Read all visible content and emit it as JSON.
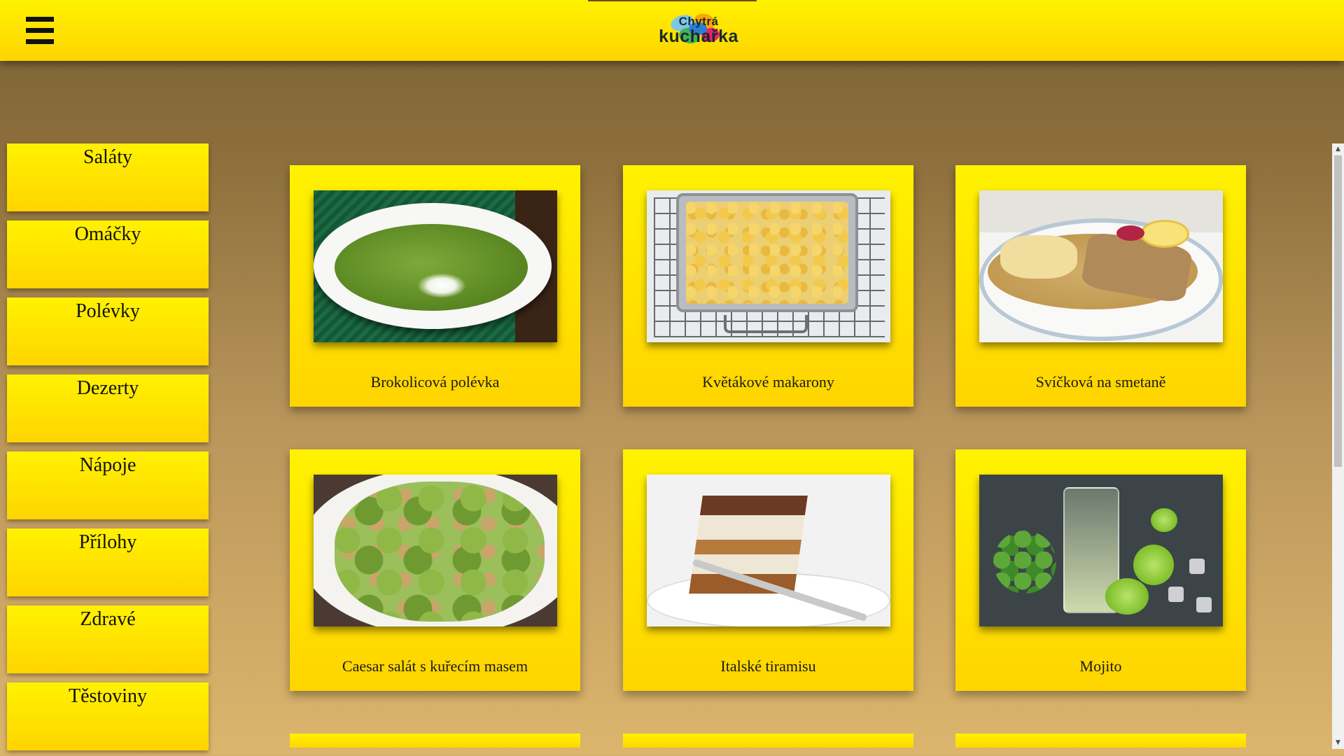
{
  "header": {
    "menu_icon": "hamburger-menu-icon",
    "logo_line1": "Chytrá",
    "logo_line2": "kuchařka"
  },
  "sidebar": {
    "items": [
      {
        "label": "Saláty"
      },
      {
        "label": "Omáčky"
      },
      {
        "label": "Polévky"
      },
      {
        "label": "Dezerty"
      },
      {
        "label": "Nápoje"
      },
      {
        "label": "Přílohy"
      },
      {
        "label": "Zdravé"
      },
      {
        "label": "Těstoviny"
      }
    ]
  },
  "recipes": [
    {
      "title": "Brokolicová polévka",
      "image": "broccoli-soup-photo"
    },
    {
      "title": "Květákové makarony",
      "image": "cauliflower-macaroni-photo"
    },
    {
      "title": "Svíčková na smetaně",
      "image": "svickova-photo"
    },
    {
      "title": "Caesar salát s kuřecím masem",
      "image": "caesar-salad-photo"
    },
    {
      "title": "Italské tiramisu",
      "image": "tiramisu-photo"
    },
    {
      "title": "Mojito",
      "image": "mojito-photo"
    }
  ],
  "colors": {
    "accent_yellow": "#fff200",
    "accent_yellow_dark": "#ffd400",
    "background_top": "#7b6335",
    "background_bottom": "#dcb56d"
  },
  "scrollbar": {
    "up_icon": "scroll-up-arrow-icon",
    "down_icon": "scroll-down-arrow-icon"
  }
}
